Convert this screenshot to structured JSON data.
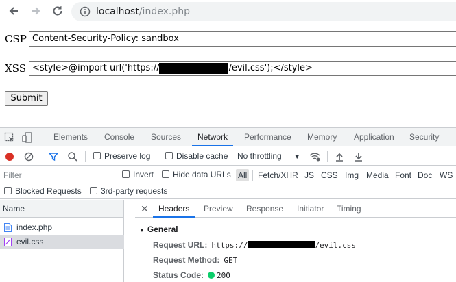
{
  "browser": {
    "url_host": "localhost",
    "url_path": "/index.php"
  },
  "form": {
    "csp_label": "CSP",
    "csp_value": "Content-Security-Policy: sandbox",
    "xss_label": "XSS",
    "xss_value_prefix": "<style>@import url('https://",
    "xss_value_suffix": "/evil.css');</style>",
    "submit_label": "Submit"
  },
  "devtools": {
    "tabs": [
      "Elements",
      "Console",
      "Sources",
      "Network",
      "Performance",
      "Memory",
      "Application",
      "Security"
    ],
    "active_tab": "Network",
    "toolbar": {
      "preserve_log": "Preserve log",
      "disable_cache": "Disable cache",
      "throttling": "No throttling"
    },
    "filter": {
      "placeholder": "Filter",
      "invert": "Invert",
      "hide_data_urls": "Hide data URLs",
      "types": [
        "All",
        "Fetch/XHR",
        "JS",
        "CSS",
        "Img",
        "Media",
        "Font",
        "Doc",
        "WS"
      ],
      "blocked_requests": "Blocked Requests",
      "third_party": "3rd-party requests"
    },
    "requests": {
      "header": "Name",
      "items": [
        "index.php",
        "evil.css"
      ]
    },
    "details": {
      "tabs": [
        "Headers",
        "Preview",
        "Response",
        "Initiator",
        "Timing"
      ],
      "active_tab": "Headers",
      "section": "General",
      "request_url_label": "Request URL:",
      "request_url_prefix": "https://",
      "request_url_suffix": "/evil.css",
      "request_method_label": "Request Method:",
      "request_method": "GET",
      "status_code_label": "Status Code:",
      "status_code": "200"
    }
  }
}
